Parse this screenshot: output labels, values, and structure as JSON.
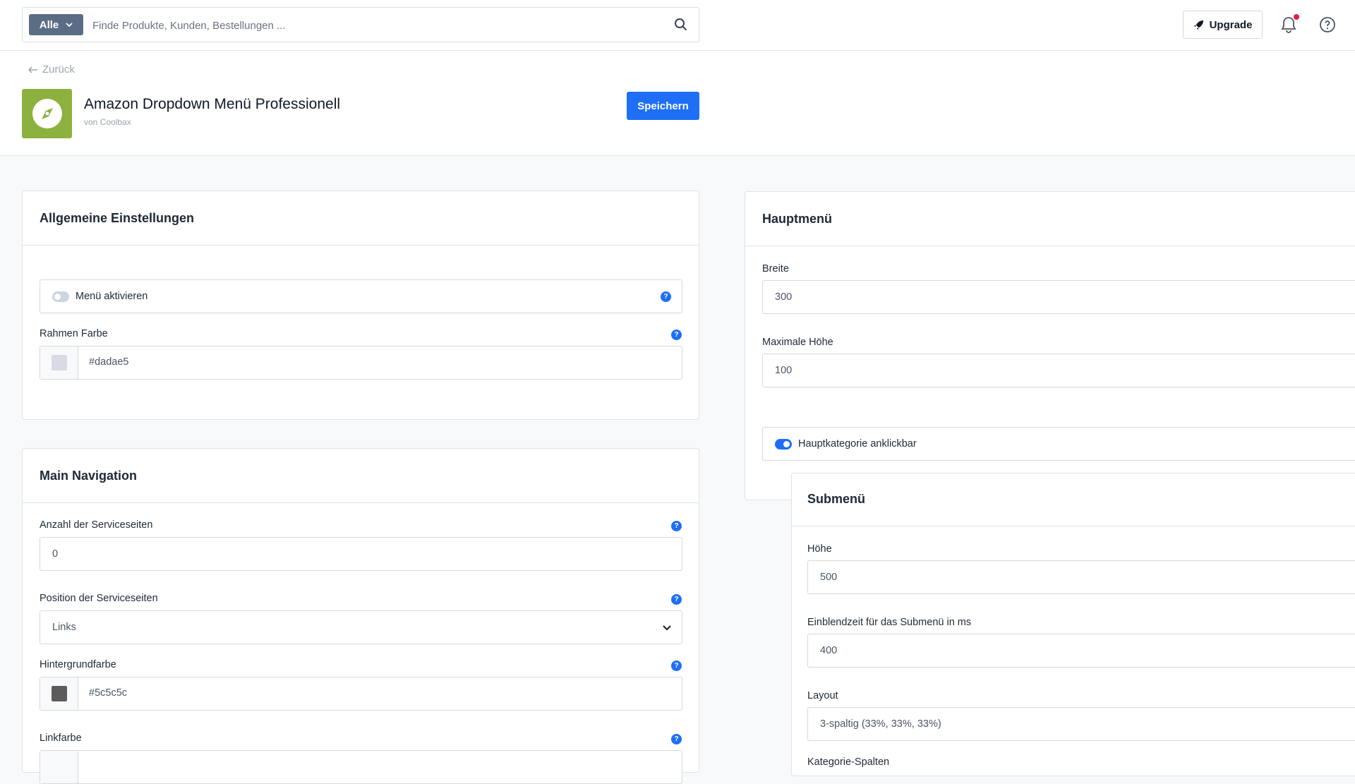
{
  "topbar": {
    "search_scope": "Alle",
    "search_placeholder": "Finde Produkte, Kunden, Bestellungen ...",
    "upgrade_label": "Upgrade"
  },
  "header": {
    "back_label": "Zurück",
    "app_title": "Amazon Dropdown Menü Professionell",
    "app_vendor": "von Coolbax",
    "save_label": "Speichern",
    "logo_color": "#8db13e"
  },
  "general": {
    "title": "Allgemeine Einstellungen",
    "menu_toggle_label": "Menü aktivieren",
    "menu_toggle_on": false,
    "border_color_label": "Rahmen Farbe",
    "border_color_value": "#dadae5"
  },
  "main_nav": {
    "title": "Main Navigation",
    "service_count_label": "Anzahl der Serviceseiten",
    "service_count_value": "0",
    "service_position_label": "Position der Serviceseiten",
    "service_position_value": "Links",
    "bg_color_label": "Hintergrundfarbe",
    "bg_color_value": "#5c5c5c",
    "link_color_label": "Linkfarbe"
  },
  "main_menu": {
    "title": "Hauptmenü",
    "width_label": "Breite",
    "width_value": "300",
    "max_height_label": "Maximale Höhe",
    "max_height_value": "100",
    "clickable_label": "Hauptkategorie anklickbar",
    "clickable_on": true
  },
  "submenu": {
    "title": "Submenü",
    "height_label": "Höhe",
    "height_value": "500",
    "fade_label": "Einblendzeit für das Submenü in ms",
    "fade_value": "400",
    "layout_label": "Layout",
    "layout_value": "3-spaltig (33%, 33%, 33%)",
    "columns_label": "Kategorie-Spalten"
  },
  "colors": {
    "accent": "#1e6ff5",
    "toggle_off": "#cbd5e1"
  }
}
